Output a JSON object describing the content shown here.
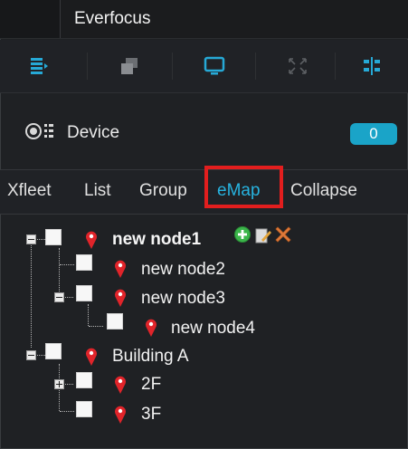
{
  "window": {
    "title": "Everfocus"
  },
  "toolbar": {
    "buttons": [
      {
        "icon": "list-view-icon"
      },
      {
        "icon": "window-stack-icon"
      },
      {
        "icon": "monitor-icon"
      },
      {
        "icon": "fullscreen-icon"
      },
      {
        "icon": "split-view-icon"
      }
    ]
  },
  "device_panel": {
    "label": "Device",
    "count": "0"
  },
  "tabs": [
    {
      "label": "Xfleet"
    },
    {
      "label": "List"
    },
    {
      "label": "Group"
    },
    {
      "label": "eMap",
      "active": true
    },
    {
      "label": "Collapse"
    }
  ],
  "tree": {
    "nodes": [
      {
        "label": "new node1",
        "bold": true,
        "expanded": true,
        "actions": [
          "add-icon",
          "edit-icon",
          "delete-icon"
        ]
      },
      {
        "label": "new node2"
      },
      {
        "label": "new node3",
        "expanded": true
      },
      {
        "label": "new node4"
      },
      {
        "label": "Building A",
        "expanded": true
      },
      {
        "label": "2F",
        "expanded": false
      },
      {
        "label": "3F"
      }
    ]
  },
  "colors": {
    "accent": "#1aa4c8",
    "active_tab": "#27b3e0",
    "highlight": "#e21e1e",
    "pin": "#e0242a"
  }
}
